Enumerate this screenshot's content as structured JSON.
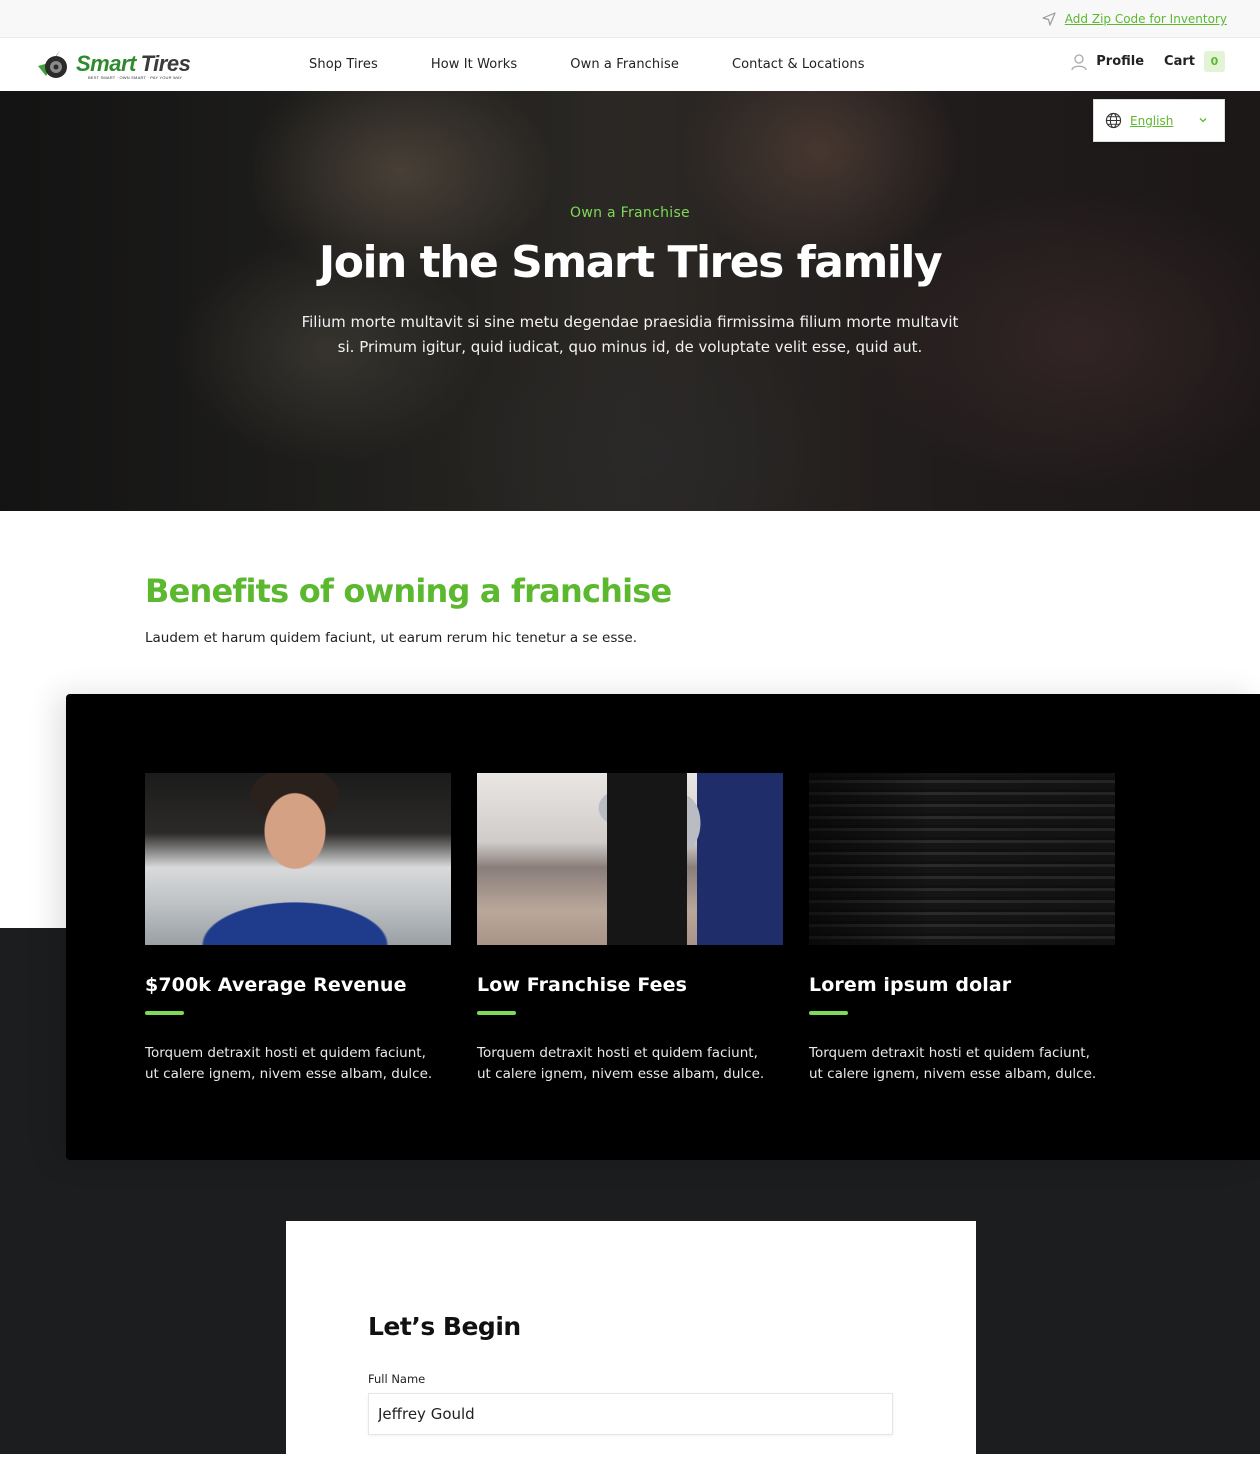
{
  "utility_bar": {
    "zip_link": "Add Zip Code for Inventory",
    "zip_icon": "location-arrow-icon"
  },
  "header": {
    "logo": {
      "brand_part1": "Smart",
      "brand_part2": "Tires",
      "tagline": "BEST SMART · OWN SMART · PAY YOUR WAY"
    },
    "nav": [
      {
        "label": "Shop Tires"
      },
      {
        "label": "How It Works"
      },
      {
        "label": "Own a Franchise"
      },
      {
        "label": "Contact & Locations"
      }
    ],
    "profile_label": "Profile",
    "cart_label": "Cart",
    "cart_count": "0"
  },
  "language": {
    "selected": "English",
    "icon": "globe-icon"
  },
  "hero": {
    "eyebrow": "Own a Franchise",
    "title": "Join the Smart Tires family",
    "description": "Filium morte multavit si sine metu degendae praesidia firmissima filium morte multavit si. Primum igitur, quid iudicat, quo minus id, de voluptate velit esse, quid aut."
  },
  "benefits": {
    "heading": "Benefits of owning a franchise",
    "subtitle": "Laudem et harum quidem faciunt, ut earum rerum hic tenetur a se esse.",
    "cards": [
      {
        "title": "$700k Average Revenue",
        "text": "Torquem detraxit hosti et quidem faciunt, ut calere ignem, nivem esse albam, dulce.",
        "image": "smiling mechanic in blue overalls"
      },
      {
        "title": "Low Franchise Fees",
        "text": "Torquem detraxit hosti et quidem faciunt, ut calere ignem, nivem esse albam, dulce.",
        "image": "gloved hands rolling a tire"
      },
      {
        "title": "Lorem ipsum dolar",
        "text": "Torquem detraxit hosti et quidem faciunt, ut calere ignem, nivem esse albam, dulce.",
        "image": "stack of tires"
      }
    ]
  },
  "form": {
    "title": "Let’s Begin",
    "full_name_label": "Full Name",
    "full_name_value": "Jeffrey Gould"
  },
  "colors": {
    "accent_green": "#5cb82e",
    "light_green": "#7ed957",
    "panel_black": "#000000",
    "dark_floor": "#1c1d1f"
  }
}
